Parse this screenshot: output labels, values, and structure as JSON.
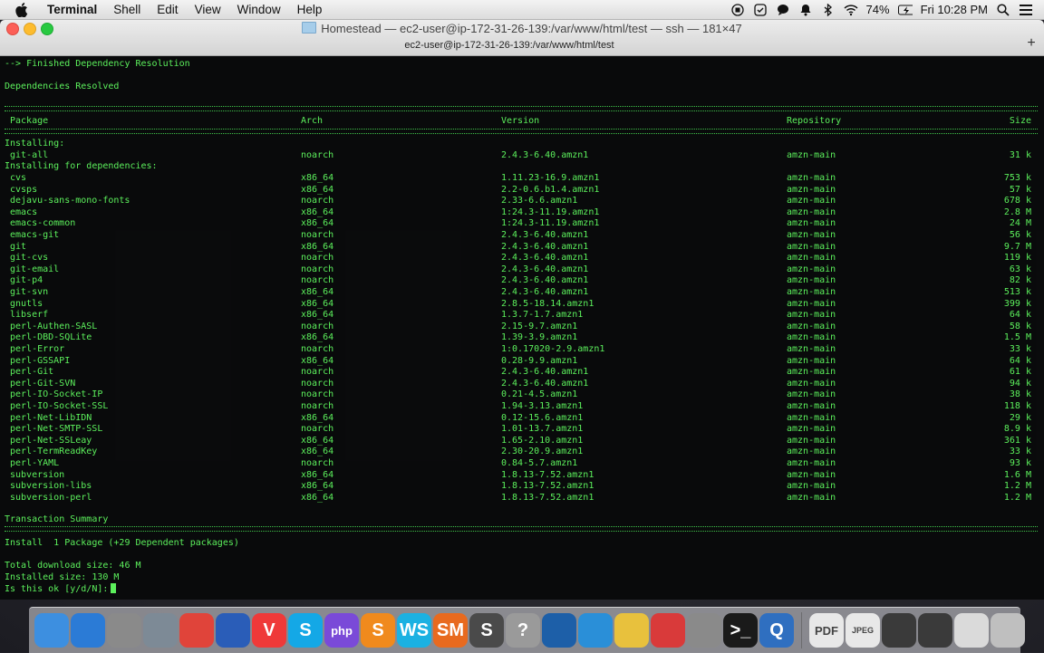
{
  "menubar": {
    "app": "Terminal",
    "items": [
      "Shell",
      "Edit",
      "View",
      "Window",
      "Help"
    ],
    "battery": "74%",
    "clock": "Fri 10:28 PM"
  },
  "window": {
    "title": "Homestead — ec2-user@ip-172-31-26-139:/var/www/html/test — ssh — 181×47",
    "tab": "ec2-user@ip-172-31-26-139:/var/www/html/test",
    "new_tab_symbol": "+"
  },
  "terminal": {
    "line_finished": "--> Finished Dependency Resolution",
    "line_resolved": "Dependencies Resolved",
    "headers": {
      "package": "Package",
      "arch": "Arch",
      "version": "Version",
      "repository": "Repository",
      "size": "Size"
    },
    "installing_label": "Installing:",
    "installing": [
      {
        "package": "git-all",
        "arch": "noarch",
        "version": "2.4.3-6.40.amzn1",
        "repo": "amzn-main",
        "size": "31 k"
      }
    ],
    "deps_label": "Installing for dependencies:",
    "deps": [
      {
        "package": "cvs",
        "arch": "x86_64",
        "version": "1.11.23-16.9.amzn1",
        "repo": "amzn-main",
        "size": "753 k"
      },
      {
        "package": "cvsps",
        "arch": "x86_64",
        "version": "2.2-0.6.b1.4.amzn1",
        "repo": "amzn-main",
        "size": "57 k"
      },
      {
        "package": "dejavu-sans-mono-fonts",
        "arch": "noarch",
        "version": "2.33-6.6.amzn1",
        "repo": "amzn-main",
        "size": "678 k"
      },
      {
        "package": "emacs",
        "arch": "x86_64",
        "version": "1:24.3-11.19.amzn1",
        "repo": "amzn-main",
        "size": "2.8 M"
      },
      {
        "package": "emacs-common",
        "arch": "x86_64",
        "version": "1:24.3-11.19.amzn1",
        "repo": "amzn-main",
        "size": "24 M"
      },
      {
        "package": "emacs-git",
        "arch": "noarch",
        "version": "2.4.3-6.40.amzn1",
        "repo": "amzn-main",
        "size": "56 k"
      },
      {
        "package": "git",
        "arch": "x86_64",
        "version": "2.4.3-6.40.amzn1",
        "repo": "amzn-main",
        "size": "9.7 M"
      },
      {
        "package": "git-cvs",
        "arch": "noarch",
        "version": "2.4.3-6.40.amzn1",
        "repo": "amzn-main",
        "size": "119 k"
      },
      {
        "package": "git-email",
        "arch": "noarch",
        "version": "2.4.3-6.40.amzn1",
        "repo": "amzn-main",
        "size": "63 k"
      },
      {
        "package": "git-p4",
        "arch": "noarch",
        "version": "2.4.3-6.40.amzn1",
        "repo": "amzn-main",
        "size": "82 k"
      },
      {
        "package": "git-svn",
        "arch": "x86_64",
        "version": "2.4.3-6.40.amzn1",
        "repo": "amzn-main",
        "size": "513 k"
      },
      {
        "package": "gnutls",
        "arch": "x86_64",
        "version": "2.8.5-18.14.amzn1",
        "repo": "amzn-main",
        "size": "399 k"
      },
      {
        "package": "libserf",
        "arch": "x86_64",
        "version": "1.3.7-1.7.amzn1",
        "repo": "amzn-main",
        "size": "64 k"
      },
      {
        "package": "perl-Authen-SASL",
        "arch": "noarch",
        "version": "2.15-9.7.amzn1",
        "repo": "amzn-main",
        "size": "58 k"
      },
      {
        "package": "perl-DBD-SQLite",
        "arch": "x86_64",
        "version": "1.39-3.9.amzn1",
        "repo": "amzn-main",
        "size": "1.5 M"
      },
      {
        "package": "perl-Error",
        "arch": "noarch",
        "version": "1:0.17020-2.9.amzn1",
        "repo": "amzn-main",
        "size": "33 k"
      },
      {
        "package": "perl-GSSAPI",
        "arch": "x86_64",
        "version": "0.28-9.9.amzn1",
        "repo": "amzn-main",
        "size": "64 k"
      },
      {
        "package": "perl-Git",
        "arch": "noarch",
        "version": "2.4.3-6.40.amzn1",
        "repo": "amzn-main",
        "size": "61 k"
      },
      {
        "package": "perl-Git-SVN",
        "arch": "noarch",
        "version": "2.4.3-6.40.amzn1",
        "repo": "amzn-main",
        "size": "94 k"
      },
      {
        "package": "perl-IO-Socket-IP",
        "arch": "noarch",
        "version": "0.21-4.5.amzn1",
        "repo": "amzn-main",
        "size": "38 k"
      },
      {
        "package": "perl-IO-Socket-SSL",
        "arch": "noarch",
        "version": "1.94-3.13.amzn1",
        "repo": "amzn-main",
        "size": "118 k"
      },
      {
        "package": "perl-Net-LibIDN",
        "arch": "x86_64",
        "version": "0.12-15.6.amzn1",
        "repo": "amzn-main",
        "size": "29 k"
      },
      {
        "package": "perl-Net-SMTP-SSL",
        "arch": "noarch",
        "version": "1.01-13.7.amzn1",
        "repo": "amzn-main",
        "size": "8.9 k"
      },
      {
        "package": "perl-Net-SSLeay",
        "arch": "x86_64",
        "version": "1.65-2.10.amzn1",
        "repo": "amzn-main",
        "size": "361 k"
      },
      {
        "package": "perl-TermReadKey",
        "arch": "x86_64",
        "version": "2.30-20.9.amzn1",
        "repo": "amzn-main",
        "size": "33 k"
      },
      {
        "package": "perl-YAML",
        "arch": "noarch",
        "version": "0.84-5.7.amzn1",
        "repo": "amzn-main",
        "size": "93 k"
      },
      {
        "package": "subversion",
        "arch": "x86_64",
        "version": "1.8.13-7.52.amzn1",
        "repo": "amzn-main",
        "size": "1.6 M"
      },
      {
        "package": "subversion-libs",
        "arch": "x86_64",
        "version": "1.8.13-7.52.amzn1",
        "repo": "amzn-main",
        "size": "1.2 M"
      },
      {
        "package": "subversion-perl",
        "arch": "x86_64",
        "version": "1.8.13-7.52.amzn1",
        "repo": "amzn-main",
        "size": "1.2 M"
      }
    ],
    "summary_label": "Transaction Summary",
    "summary_line": "Install  1 Package (+29 Dependent packages)",
    "download_size": "Total download size: 46 M",
    "installed_size": "Installed size: 130 M",
    "prompt": "Is this ok [y/d/N]:"
  },
  "dock": {
    "items": [
      {
        "name": "finder",
        "label": "",
        "color": "#3d8fe0"
      },
      {
        "name": "safari",
        "label": "",
        "color": "#2b7bd6"
      },
      {
        "name": "launchpad",
        "label": "",
        "color": "#8a8a8a"
      },
      {
        "name": "rocket",
        "label": "",
        "color": "#7d8a96"
      },
      {
        "name": "chrome",
        "label": "",
        "color": "#e0443a"
      },
      {
        "name": "firefox",
        "label": "",
        "color": "#2a5db8"
      },
      {
        "name": "vivaldi",
        "label": "V",
        "color": "#ef3939"
      },
      {
        "name": "skype",
        "label": "S",
        "color": "#14a8e6"
      },
      {
        "name": "phpstorm",
        "label": "php",
        "color": "#7a4ad8"
      },
      {
        "name": "sublime-s",
        "label": "S",
        "color": "#f08a1d"
      },
      {
        "name": "webstorm",
        "label": "WS",
        "color": "#1bb1e2"
      },
      {
        "name": "smartgit",
        "label": "SM",
        "color": "#e86a1f"
      },
      {
        "name": "sublime-text",
        "label": "S",
        "color": "#4a4a4a"
      },
      {
        "name": "help",
        "label": "?",
        "color": "#9a9a9a"
      },
      {
        "name": "sourcetree",
        "label": "",
        "color": "#1d5fa8"
      },
      {
        "name": "reeder",
        "label": "",
        "color": "#2a8fd8"
      },
      {
        "name": "photos",
        "label": "",
        "color": "#e8c13d"
      },
      {
        "name": "popcorn",
        "label": "",
        "color": "#d93a3a"
      },
      {
        "name": "system-preferences",
        "label": "",
        "color": "#8a8a8a"
      },
      {
        "name": "terminal",
        "label": ">_",
        "color": "#1a1a1a"
      },
      {
        "name": "quicktime",
        "label": "Q",
        "color": "#2f6fc0"
      },
      {
        "name": "pdf-doc",
        "label": "PDF",
        "color": "#e8e8e8"
      },
      {
        "name": "jpeg-doc",
        "label": "JPEG",
        "color": "#e8e8e8"
      },
      {
        "name": "screenshot-1",
        "label": "",
        "color": "#3a3a3a"
      },
      {
        "name": "screenshot-2",
        "label": "",
        "color": "#3a3a3a"
      },
      {
        "name": "screenshot-3",
        "label": "",
        "color": "#dadada"
      },
      {
        "name": "trash",
        "label": "",
        "color": "#bfbfbf"
      }
    ]
  }
}
